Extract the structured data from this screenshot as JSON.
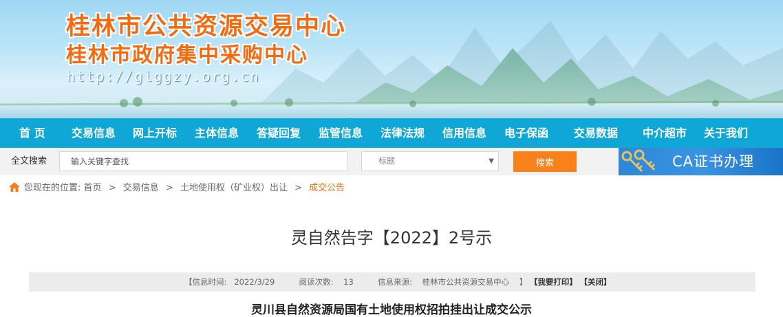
{
  "header": {
    "title_primary": "桂林市公共资源交易中心",
    "title_secondary": "桂林市政府集中采购中心",
    "site_url": "http://glggzy.org.cn"
  },
  "nav": {
    "items": [
      {
        "label": "首 页"
      },
      {
        "label": "交易信息"
      },
      {
        "label": "网上开标"
      },
      {
        "label": "主体信息"
      },
      {
        "label": "答疑回复"
      },
      {
        "label": "监管信息"
      },
      {
        "label": "法律法规"
      },
      {
        "label": "信用信息"
      },
      {
        "label": "电子保函"
      },
      {
        "label": "交易数据"
      },
      {
        "label": "中介超市"
      },
      {
        "label": "关于我们"
      }
    ]
  },
  "search": {
    "label": "全文搜索",
    "placeholder": "输入关键字查找",
    "select_value": "标题",
    "button_label": "搜索",
    "ca_label": "CA证书办理"
  },
  "breadcrumb": {
    "prefix": "您现在的位置:",
    "items": [
      "首页",
      "交易信息",
      "土地使用权（矿业权）出让"
    ],
    "current": "成交公告",
    "separator": ">"
  },
  "article": {
    "title": "灵自然告字【2022】2号示",
    "info": {
      "time_label": "【信息时间:",
      "time_value": "2022/3/29",
      "views_label": "阅读次数:",
      "views_value": "13",
      "source_label": "信息来源:",
      "source_value": "桂林市公共资源交易中心",
      "close_bracket": "】",
      "print_label": "【我要打印】",
      "close_label": "【关闭】"
    },
    "heading": "灵川县自然资源局国有土地使用权招拍挂出让成交公示"
  },
  "colors": {
    "nav_bg": "#0fa7d6",
    "accent_orange": "#f36b10",
    "button_orange": "#f7821b",
    "ca_blue": "#2d86d8"
  }
}
